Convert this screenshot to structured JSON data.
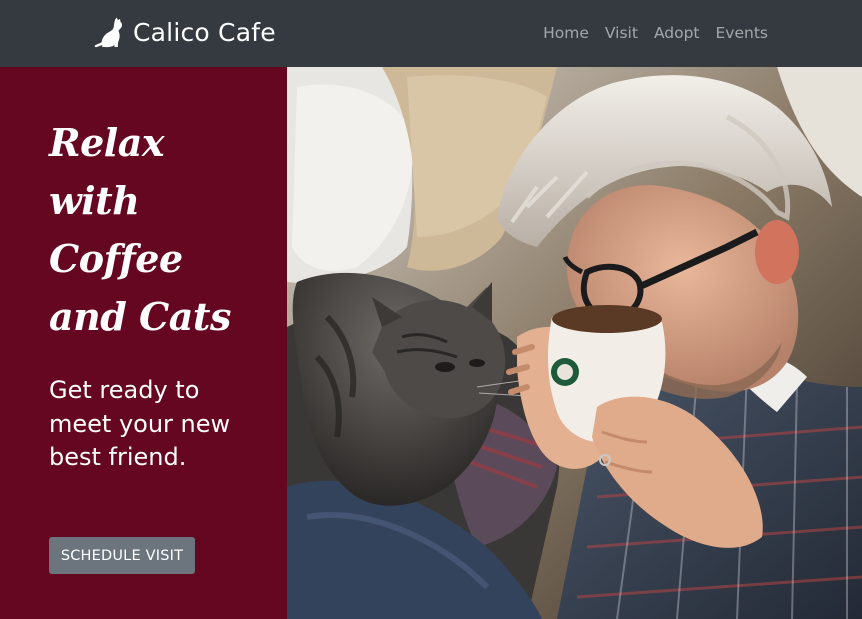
{
  "navbar": {
    "brand": "Calico Cafe",
    "brand_icon": "cat-silhouette-icon",
    "links": [
      "Home",
      "Visit",
      "Adopt",
      "Events"
    ]
  },
  "hero": {
    "headline_lines": [
      "Relax",
      "with",
      "Coffee",
      "and Cats"
    ],
    "tagline": "Get ready to meet your new best friend.",
    "cta_label": "SCHEDULE VISIT",
    "accent_color": "#650720",
    "cta_color": "#6c757d"
  },
  "photo": {
    "description_icon": "man-drinking-coffee-with-cat-photo"
  }
}
